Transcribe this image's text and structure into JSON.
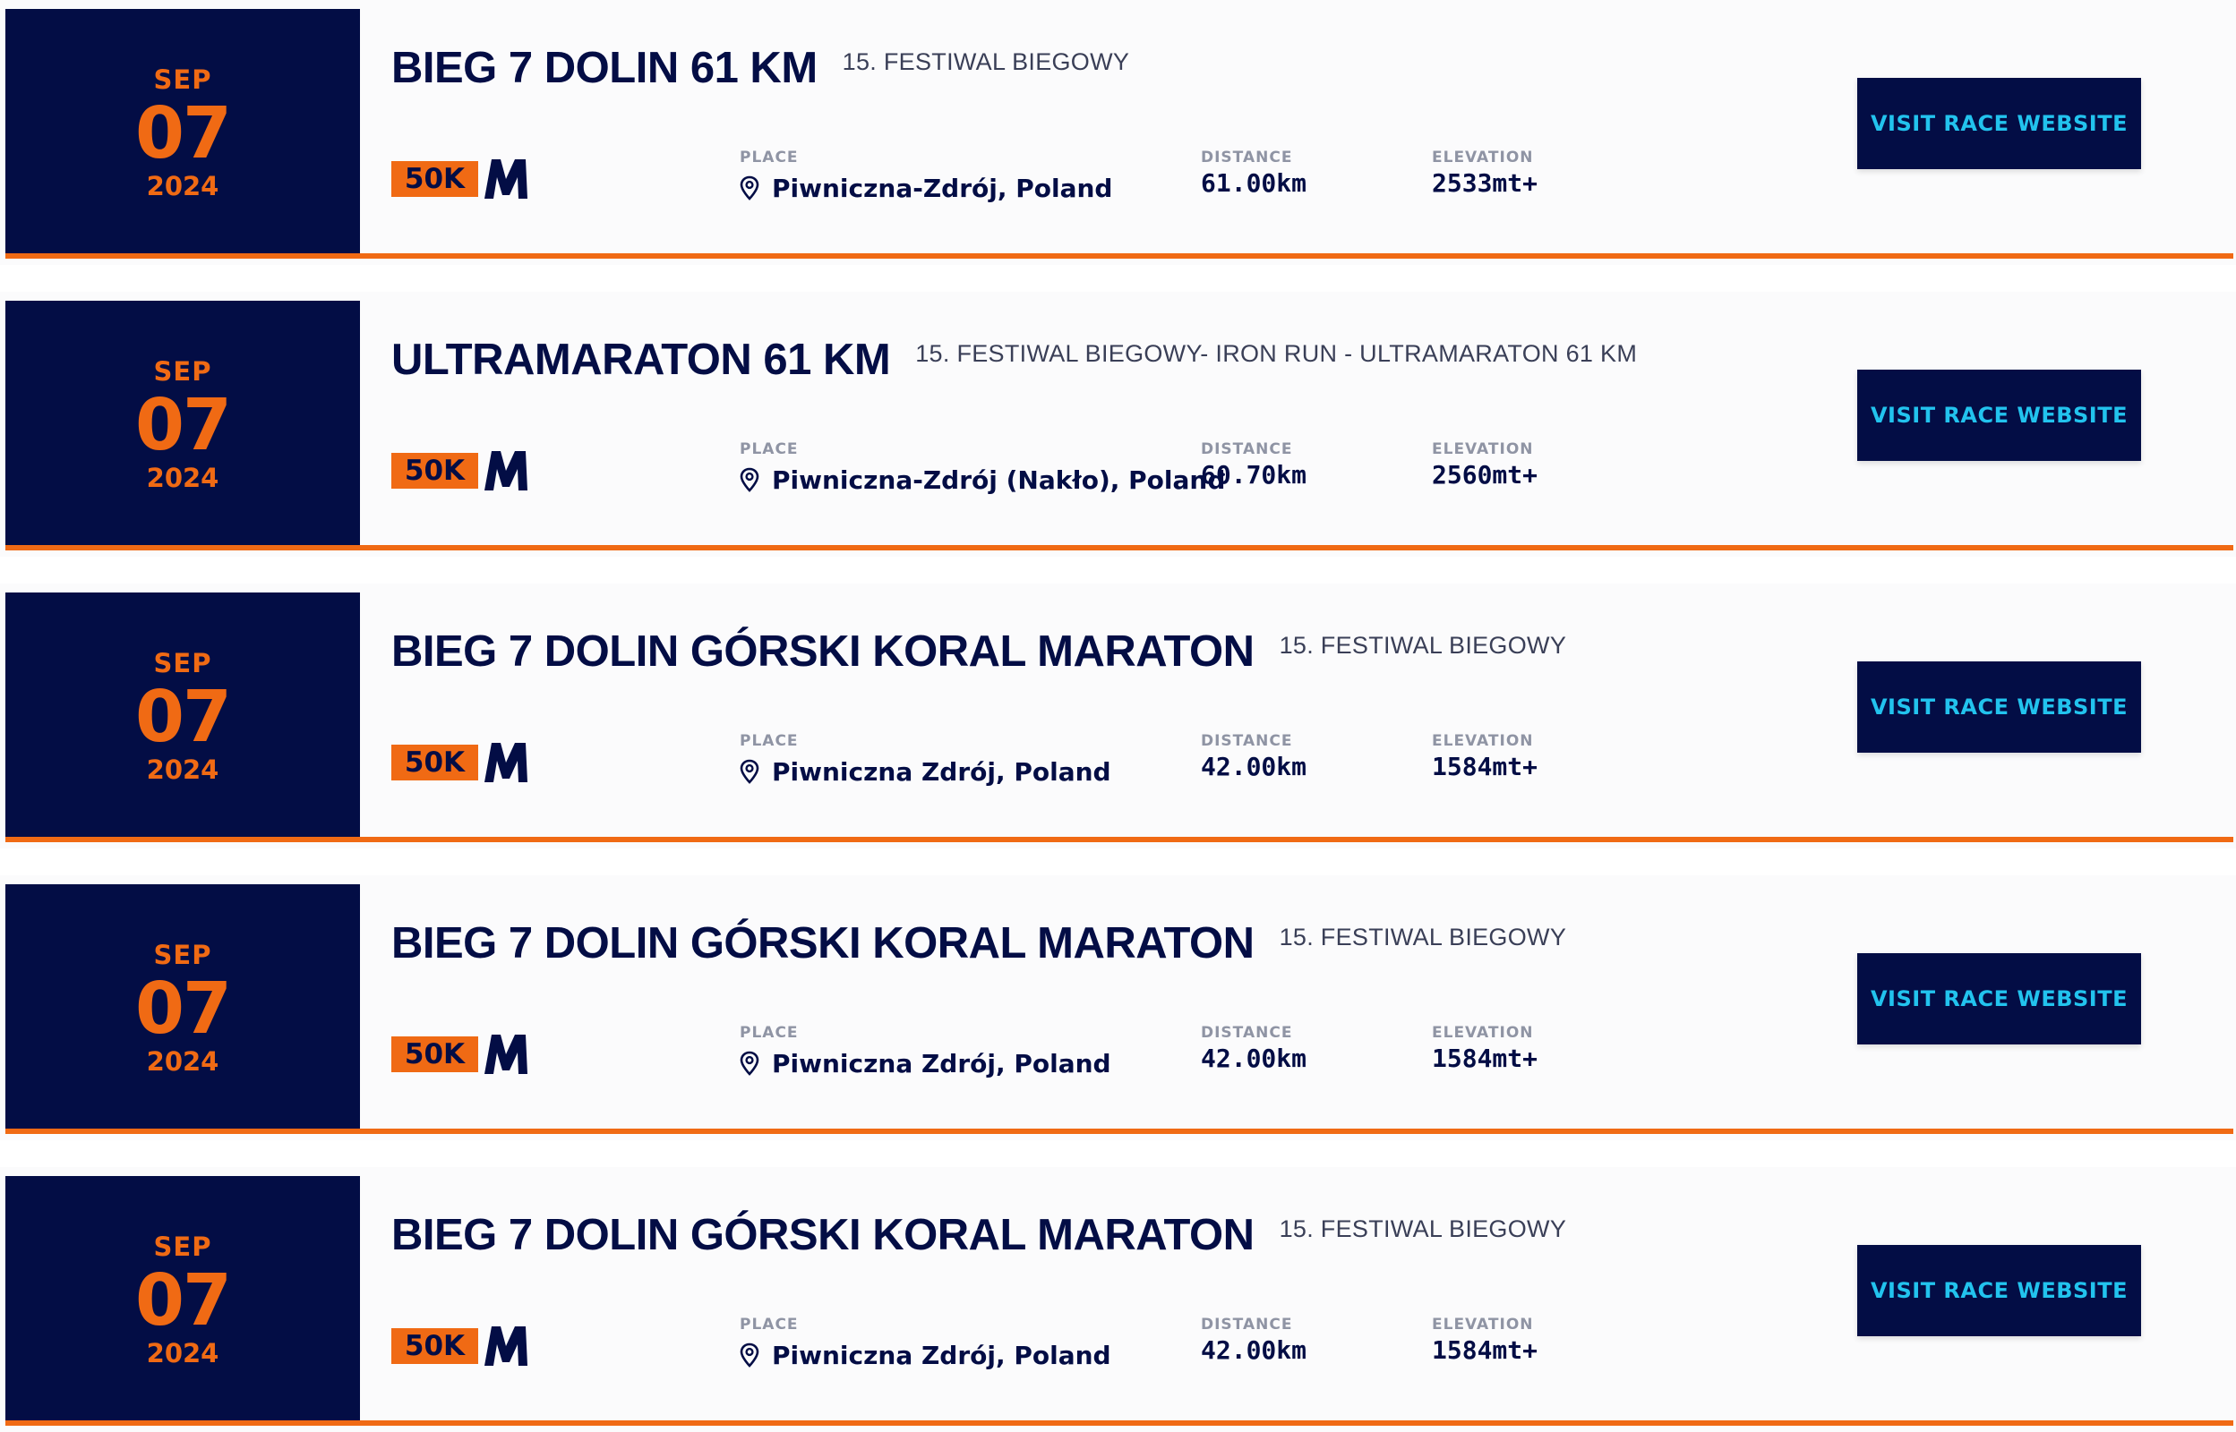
{
  "races": [
    {
      "month": "SEP",
      "day": "07",
      "year": "2024",
      "title": "BIEG 7 DOLIN 61 KM",
      "subtitle": "15. FESTIWAL BIEGOWY",
      "badge": "50K",
      "badge_letter_icon": "m-logo-icon",
      "place_label": "PLACE",
      "place": "Piwniczna-Zdrój, Poland",
      "distance_label": "DISTANCE",
      "distance": "61.00km",
      "elevation_label": "ELEVATION",
      "elevation": "2533mt+",
      "button_label": "VISIT RACE WEBSITE"
    },
    {
      "month": "SEP",
      "day": "07",
      "year": "2024",
      "title": "ULTRAMARATON 61 KM",
      "subtitle": "15. FESTIWAL BIEGOWY- IRON RUN - ULTRAMARATON 61 KM",
      "badge": "50K",
      "badge_letter_icon": "m-logo-icon",
      "place_label": "PLACE",
      "place": "Piwniczna-Zdrój (Nakło), Poland",
      "distance_label": "DISTANCE",
      "distance": "60.70km",
      "elevation_label": "ELEVATION",
      "elevation": "2560mt+",
      "button_label": "VISIT RACE WEBSITE"
    },
    {
      "month": "SEP",
      "day": "07",
      "year": "2024",
      "title": "BIEG 7 DOLIN GÓRSKI KORAL MARATON",
      "subtitle": "15. FESTIWAL BIEGOWY",
      "badge": "50K",
      "badge_letter_icon": "m-logo-icon",
      "place_label": "PLACE",
      "place": "Piwniczna Zdrój, Poland",
      "distance_label": "DISTANCE",
      "distance": "42.00km",
      "elevation_label": "ELEVATION",
      "elevation": "1584mt+",
      "button_label": "VISIT RACE WEBSITE"
    },
    {
      "month": "SEP",
      "day": "07",
      "year": "2024",
      "title": "BIEG 7 DOLIN GÓRSKI KORAL MARATON",
      "subtitle": "15. FESTIWAL BIEGOWY",
      "badge": "50K",
      "badge_letter_icon": "m-logo-icon",
      "place_label": "PLACE",
      "place": "Piwniczna Zdrój, Poland",
      "distance_label": "DISTANCE",
      "distance": "42.00km",
      "elevation_label": "ELEVATION",
      "elevation": "1584mt+",
      "button_label": "VISIT RACE WEBSITE"
    },
    {
      "month": "SEP",
      "day": "07",
      "year": "2024",
      "title": "BIEG 7 DOLIN GÓRSKI KORAL MARATON",
      "subtitle": "15. FESTIWAL BIEGOWY",
      "badge": "50K",
      "badge_letter_icon": "m-logo-icon",
      "place_label": "PLACE",
      "place": "Piwniczna Zdrój, Poland",
      "distance_label": "DISTANCE",
      "distance": "42.00km",
      "elevation_label": "ELEVATION",
      "elevation": "1584mt+",
      "button_label": "VISIT RACE WEBSITE"
    }
  ],
  "colors": {
    "navy": "#030d45",
    "orange": "#f06a14",
    "cyan": "#22c3ee",
    "label_gray": "#8f94a4"
  }
}
